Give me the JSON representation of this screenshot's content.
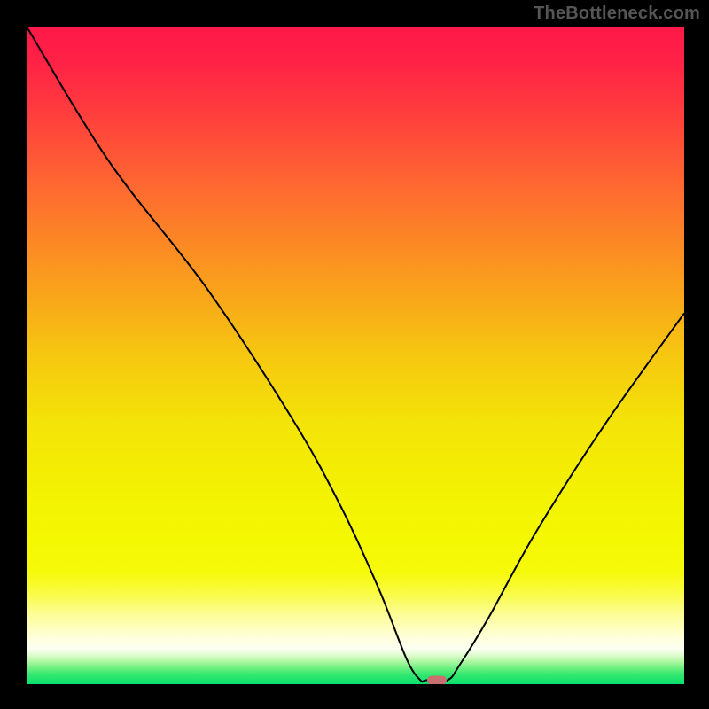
{
  "watermark": "TheBottleneck.com",
  "chart_data": {
    "type": "line",
    "title": "",
    "xlabel": "",
    "ylabel": "",
    "xlim": [
      0,
      100
    ],
    "ylim": [
      0,
      100
    ],
    "grid": false,
    "legend": false,
    "background_gradient": {
      "stops": [
        {
          "offset": 0.0,
          "color": "#ff1848"
        },
        {
          "offset": 0.05,
          "color": "#ff2146"
        },
        {
          "offset": 0.123,
          "color": "#ff3a3e"
        },
        {
          "offset": 0.25,
          "color": "#fe6b30"
        },
        {
          "offset": 0.35,
          "color": "#fb9022"
        },
        {
          "offset": 0.5,
          "color": "#f6c710"
        },
        {
          "offset": 0.6,
          "color": "#f4e308"
        },
        {
          "offset": 0.72,
          "color": "#f3f302"
        },
        {
          "offset": 0.78,
          "color": "#f4f801"
        },
        {
          "offset": 0.83,
          "color": "#f6fa0b"
        },
        {
          "offset": 0.86,
          "color": "#f9fb40"
        },
        {
          "offset": 0.89,
          "color": "#fcfd8e"
        },
        {
          "offset": 0.93,
          "color": "#ffffdd"
        },
        {
          "offset": 0.946,
          "color": "#fcfff1"
        },
        {
          "offset": 0.955,
          "color": "#e2fcd2"
        },
        {
          "offset": 0.964,
          "color": "#b7f8a9"
        },
        {
          "offset": 0.975,
          "color": "#71f083"
        },
        {
          "offset": 0.985,
          "color": "#35e870"
        },
        {
          "offset": 1.0,
          "color": "#09e06d"
        }
      ]
    },
    "series": [
      {
        "name": "bottleneck-curve",
        "x": [
          0.0,
          12.6,
          27.4,
          40.5,
          47.8,
          53.6,
          57.8,
          59.9,
          60.8,
          64.0,
          65.9,
          70.3,
          77.5,
          88.0,
          100.0
        ],
        "values": [
          100.0,
          79.4,
          60.2,
          40.2,
          27.0,
          14.4,
          3.8,
          0.6,
          0.6,
          0.6,
          3.0,
          10.2,
          23.2,
          39.6,
          56.4
        ],
        "color": "#000000",
        "linewidth": 2
      }
    ],
    "marker": {
      "name": "selected-point",
      "x": 62.4,
      "y": 0.6,
      "color": "#c96f6f",
      "shape": "capsule"
    }
  }
}
